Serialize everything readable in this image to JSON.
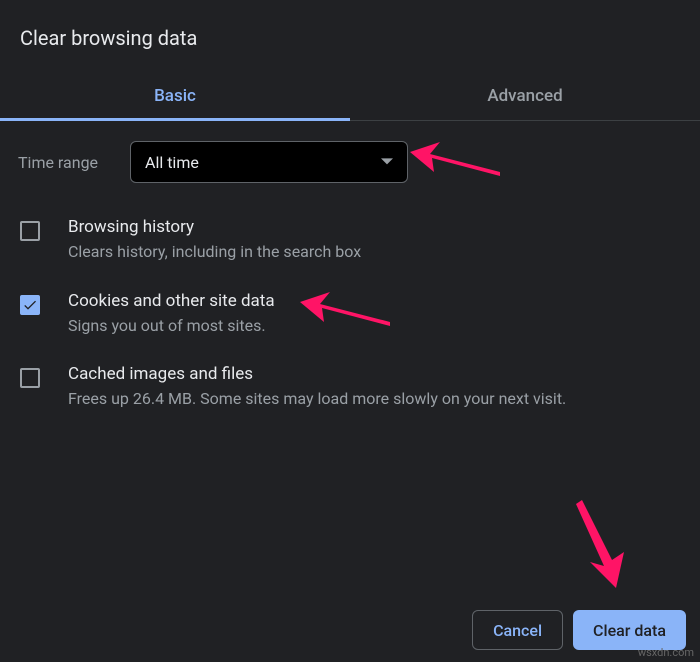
{
  "dialog": {
    "title": "Clear browsing data",
    "tabs": {
      "basic": "Basic",
      "advanced": "Advanced"
    },
    "time_range": {
      "label": "Time range",
      "value": "All time"
    },
    "options": [
      {
        "title": "Browsing history",
        "desc": "Clears history, including in the search box",
        "checked": false
      },
      {
        "title": "Cookies and other site data",
        "desc": "Signs you out of most sites.",
        "checked": true
      },
      {
        "title": "Cached images and files",
        "desc": "Frees up 26.4 MB. Some sites may load more slowly on your next visit.",
        "checked": false
      }
    ],
    "buttons": {
      "cancel": "Cancel",
      "clear": "Clear data"
    }
  },
  "watermark": "wsxdn.com",
  "colors": {
    "accent": "#8ab4f8",
    "arrow": "#ff1466"
  }
}
